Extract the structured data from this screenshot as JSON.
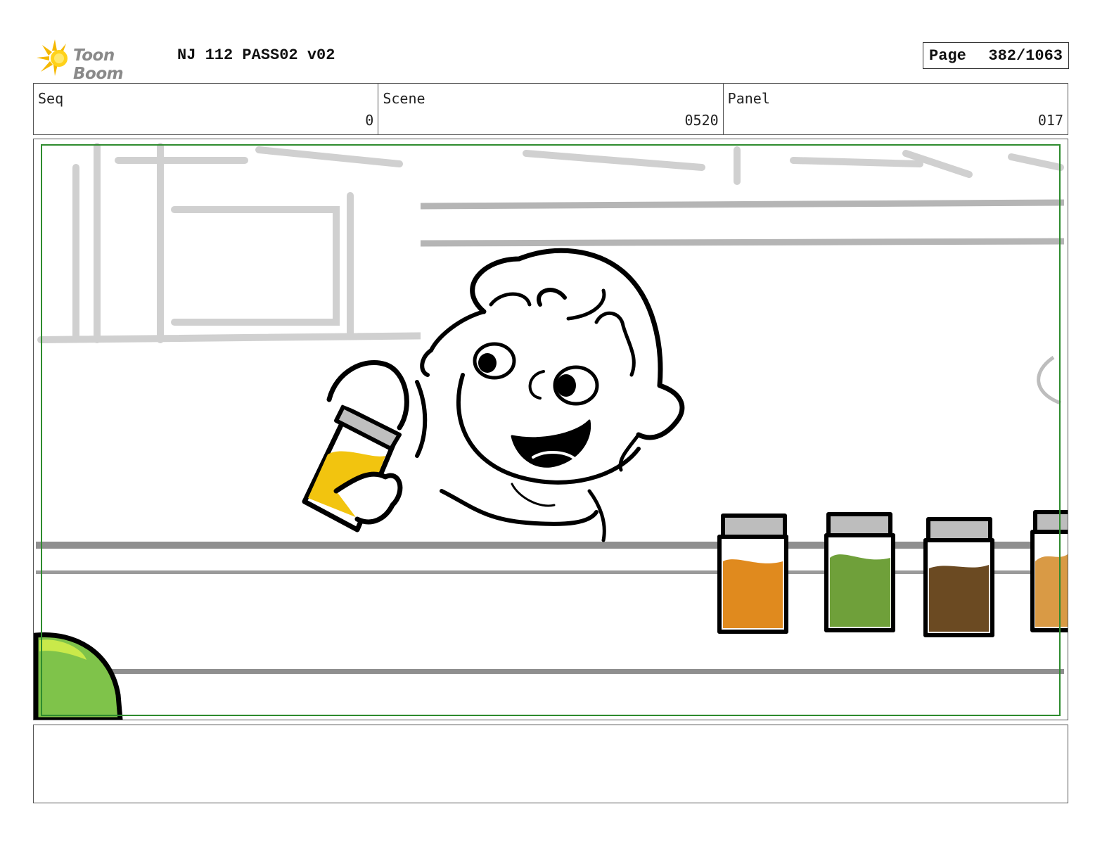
{
  "header": {
    "logo_text": "Toon Boom",
    "title": "NJ 112 PASS02 v02",
    "page_label": "Page",
    "page_value": "382/1063"
  },
  "info": {
    "seq_label": "Seq",
    "seq_value": "0",
    "scene_label": "Scene",
    "scene_value": "0520",
    "panel_label": "Panel",
    "panel_value": "017"
  },
  "colors": {
    "safe_frame": "#2e8b2e",
    "yellow_liquid": "#f2c40f",
    "orange_liquid": "#e08a1e",
    "green_liquid": "#6fa03a",
    "brown_liquid": "#6b4a22",
    "tan_liquid": "#d99a45",
    "ball_green": "#7fc34a"
  },
  "notes": {
    "text": ""
  }
}
